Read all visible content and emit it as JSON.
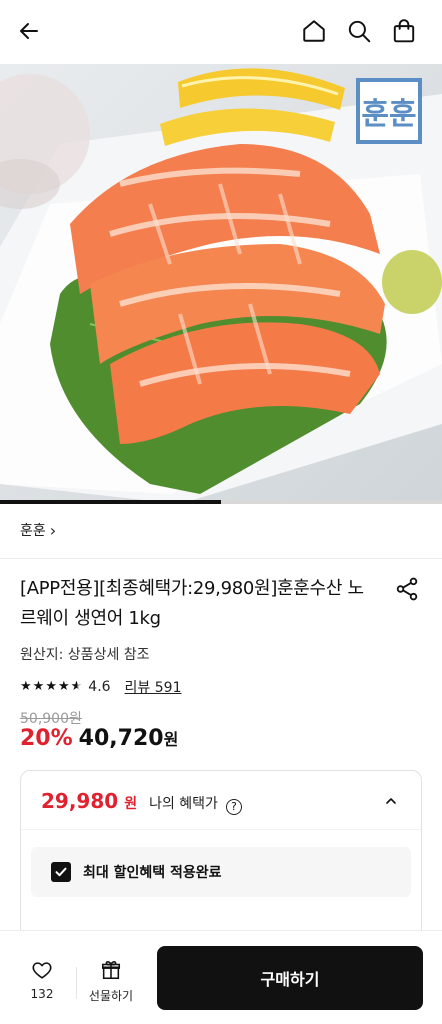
{
  "header": {
    "icons": [
      "back-icon",
      "home-icon",
      "search-icon",
      "bag-icon"
    ]
  },
  "hero": {
    "logo_text": "훈훈",
    "image_index_fraction": 0.5
  },
  "brand": {
    "name": "훈훈",
    "chevron": "›"
  },
  "product": {
    "title": "[APP전용][최종혜택가:29,980원]훈훈수산 노르웨이 생연어 1kg",
    "origin": "원산지: 상품상세 참조",
    "rating": "4.6",
    "review_label": "리뷰 591",
    "original_price": "50,900원",
    "discount": "20%",
    "price": "40,720",
    "price_unit": "원"
  },
  "benefit": {
    "price": "29,980",
    "unit": "원",
    "label": "나의 혜택가",
    "help": "?",
    "max_discount_label": "최대 할인혜택 적용완료"
  },
  "bottom": {
    "wish_count": "132",
    "gift_label": "선물하기",
    "buy_label": "구매하기"
  },
  "colors": {
    "accent_red": "#e0212f",
    "dark": "#111111",
    "salmon": "#f47e4e"
  }
}
